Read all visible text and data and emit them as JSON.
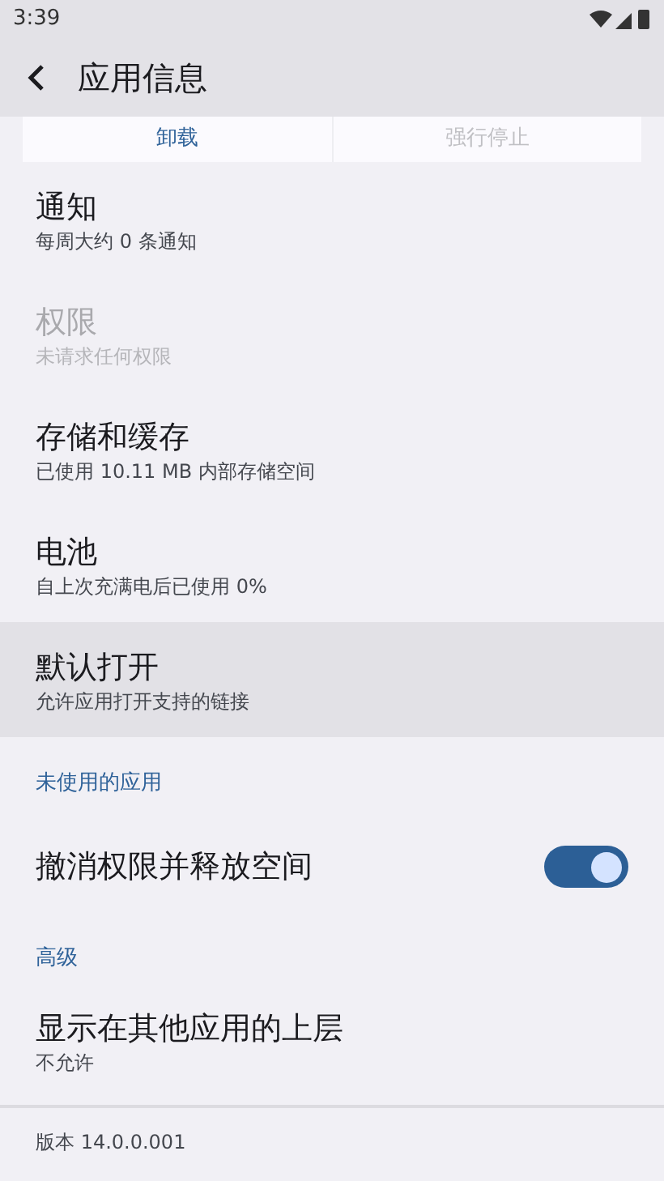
{
  "status_bar": {
    "time": "3:39"
  },
  "app_bar": {
    "title": "应用信息"
  },
  "actions": [
    {
      "label": "卸载",
      "disabled": false
    },
    {
      "label": "强行停止",
      "disabled": true
    }
  ],
  "rows": [
    {
      "kind": "item",
      "title": "通知",
      "summary": "每周大约 0 条通知",
      "disabled": false,
      "selected": false
    },
    {
      "kind": "item",
      "title": "权限",
      "summary": "未请求任何权限",
      "disabled": true,
      "selected": false
    },
    {
      "kind": "item",
      "title": "存储和缓存",
      "summary": "已使用 10.11 MB 内部存储空间",
      "disabled": false,
      "selected": false
    },
    {
      "kind": "item",
      "title": "电池",
      "summary": "自上次充满电后已使用 0%",
      "disabled": false,
      "selected": false
    },
    {
      "kind": "item",
      "title": "默认打开",
      "summary": "允许应用打开支持的链接",
      "disabled": false,
      "selected": true
    },
    {
      "kind": "header",
      "title": "未使用的应用"
    },
    {
      "kind": "switch",
      "title": "撤消权限并释放空间",
      "on": true
    },
    {
      "kind": "header",
      "title": "高级"
    },
    {
      "kind": "item",
      "title": "显示在其他应用的上层",
      "summary": "不允许",
      "disabled": false,
      "selected": false
    }
  ],
  "footer": {
    "version": "版本 14.0.0.001"
  }
}
